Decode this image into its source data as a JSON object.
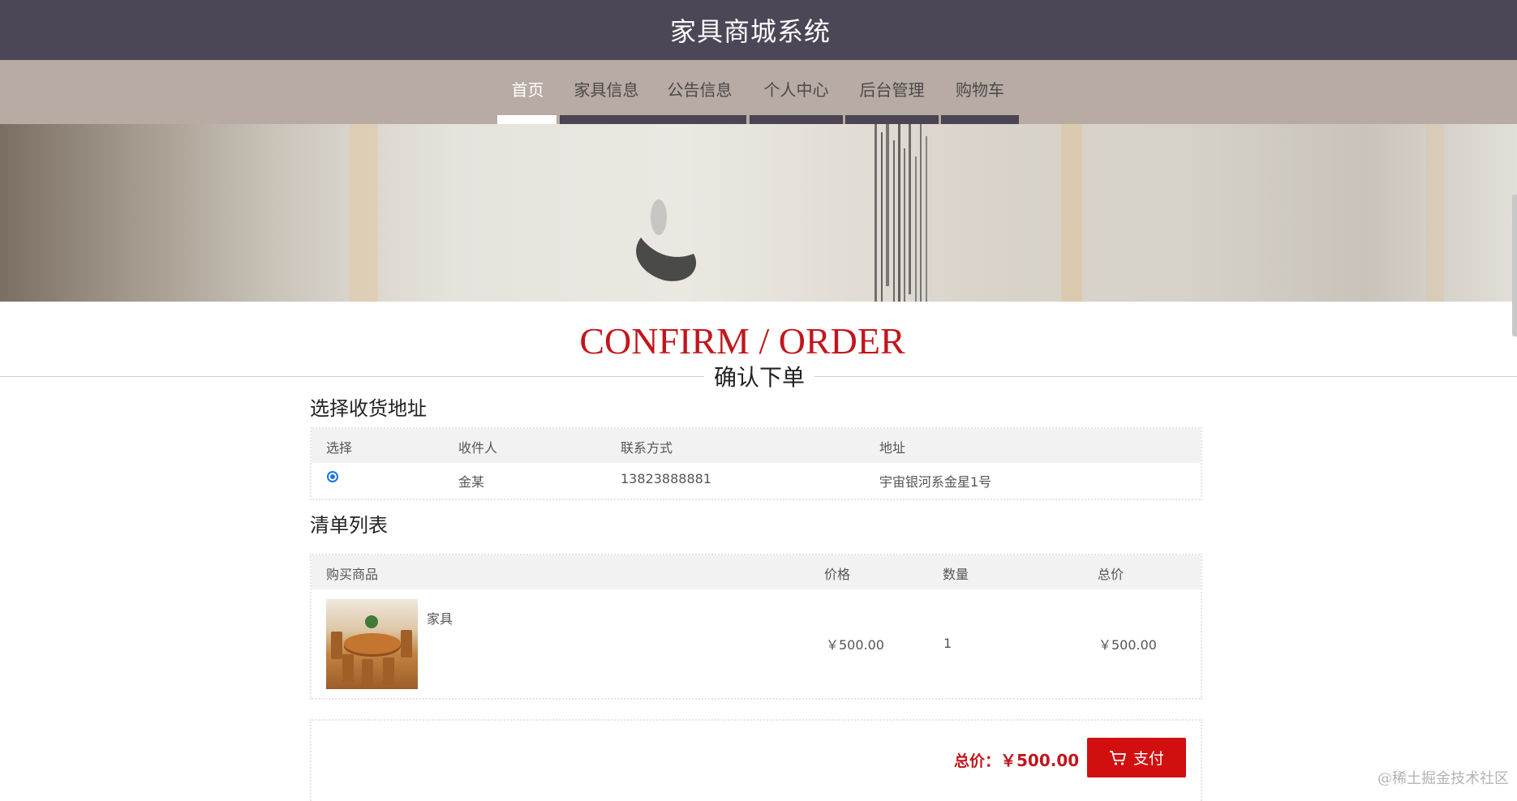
{
  "header": {
    "title": "家具商城系统"
  },
  "nav": {
    "items": [
      {
        "label": "首页",
        "active": true
      },
      {
        "label": "家具信息",
        "active": false
      },
      {
        "label": "公告信息",
        "active": false
      },
      {
        "label": "个人中心",
        "active": false
      },
      {
        "label": "后台管理",
        "active": false
      },
      {
        "label": "购物车",
        "active": false
      }
    ]
  },
  "heading": {
    "en": "CONFIRM / ORDER",
    "cn": "确认下单"
  },
  "address": {
    "title": "选择收货地址",
    "columns": [
      "选择",
      "收件人",
      "联系方式",
      "地址"
    ],
    "rows": [
      {
        "selected": true,
        "name": "金某",
        "phone": "13823888881",
        "address": "宇宙银河系金星1号"
      }
    ]
  },
  "order": {
    "title": "清单列表",
    "columns": [
      "购买商品",
      "价格",
      "数量",
      "总价"
    ],
    "items": [
      {
        "image": "round-dining-table-photo",
        "name": "家具",
        "price": "￥500.00",
        "quantity": "1",
        "total": "￥500.00"
      }
    ]
  },
  "summary": {
    "label": "总价：",
    "value": "￥500.00",
    "pay_label": "支付"
  },
  "watermark": "@稀土掘金技术社区",
  "colors": {
    "header_bg": "#4d4656",
    "nav_bg": "#b7aba3",
    "accent": "#c2161c",
    "pay_button": "#d20f0f"
  }
}
